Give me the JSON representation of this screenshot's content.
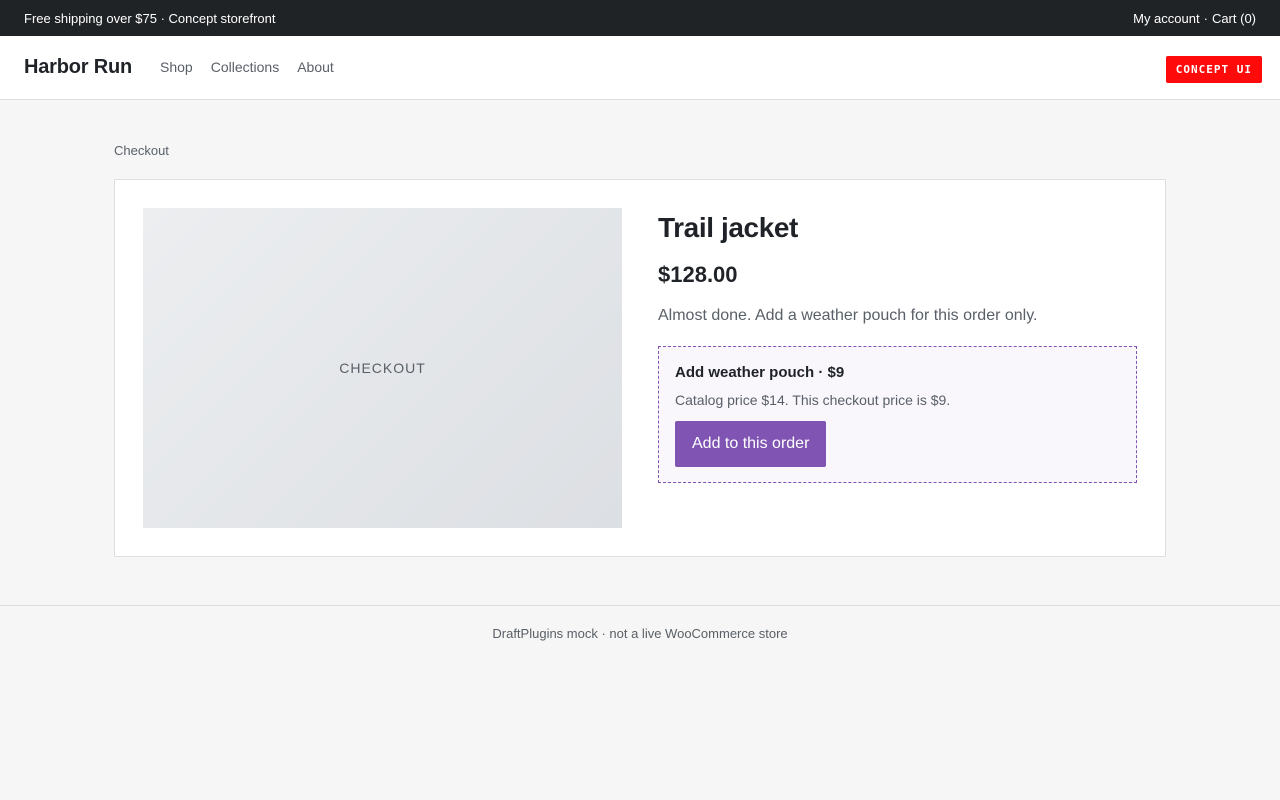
{
  "topbar": {
    "promo": "Free shipping over $75 · Concept storefront",
    "account_link": "My account",
    "separator": "·",
    "cart_link": "Cart (0)"
  },
  "header": {
    "brand": "Harbor Run",
    "nav": [
      "Shop",
      "Collections",
      "About"
    ],
    "badge": "CONCEPT UI"
  },
  "breadcrumb": "Checkout",
  "product": {
    "image_label": "CHECKOUT",
    "title": "Trail jacket",
    "price": "$128.00",
    "description": "Almost done. Add a weather pouch for this order only."
  },
  "offer": {
    "title": "Add weather pouch · $9",
    "note": "Catalog price $14. This checkout price is $9.",
    "button_label": "Add to this order"
  },
  "footer": {
    "text": "DraftPlugins mock · not a live WooCommerce store"
  },
  "colors": {
    "topbar_bg": "#1f2326",
    "accent": "#7f54b3",
    "badge_bg": "#ff0a0a",
    "page_bg": "#f5f6f5"
  }
}
